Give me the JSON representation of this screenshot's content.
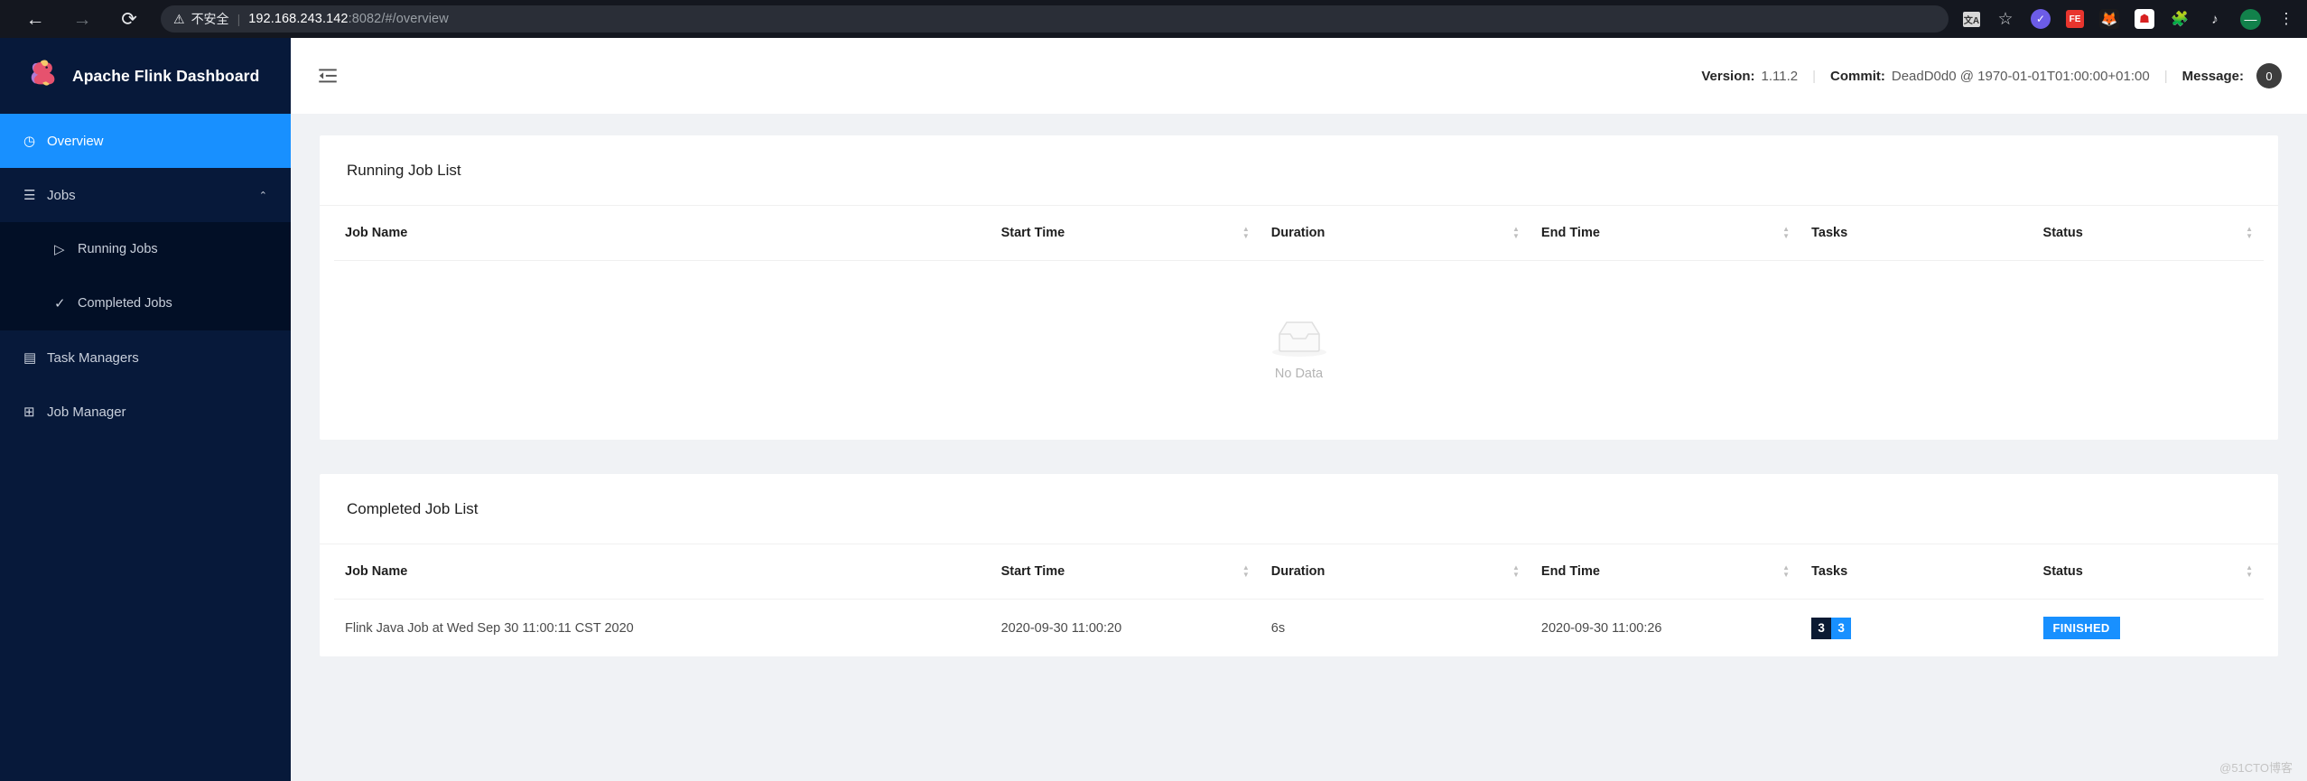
{
  "browser": {
    "nav": {
      "back_icon": "arrow-left-icon",
      "forward_icon": "arrow-right-icon",
      "reload_icon": "reload-icon",
      "back_glyph": "←",
      "forward_glyph": "→",
      "reload_glyph": "⟳"
    },
    "omnibox": {
      "warning_glyph": "⚠",
      "security_text": "不安全",
      "separator": "|",
      "url_host": "192.168.243.142",
      "url_rest": ":8082/#/overview"
    },
    "toolbar_icons": [
      {
        "name": "translate-icon",
        "glyph": "文A"
      },
      {
        "name": "bookmark-star-icon",
        "glyph": "☆"
      },
      {
        "name": "extension-check-icon",
        "glyph": "✓"
      },
      {
        "name": "extension-fe-icon",
        "glyph": "FE"
      },
      {
        "name": "extension-fox-icon",
        "glyph": "🦊"
      },
      {
        "name": "extension-network-icon",
        "glyph": "☗"
      },
      {
        "name": "extensions-puzzle-icon",
        "glyph": "🧩"
      },
      {
        "name": "reading-list-icon",
        "glyph": "♪"
      },
      {
        "name": "profile-avatar-icon",
        "glyph": "—"
      },
      {
        "name": "chrome-menu-icon",
        "glyph": "⋮"
      }
    ]
  },
  "sidebar": {
    "brand_title": "Apache Flink Dashboard",
    "brand_logo_name": "flink-squirrel-logo",
    "items": [
      {
        "label": "Overview",
        "icon": "dashboard-icon",
        "icon_glyph": "◷",
        "active": true,
        "level": 0,
        "chevron": ""
      },
      {
        "label": "Jobs",
        "icon": "list-icon",
        "icon_glyph": "☰",
        "active": false,
        "level": 0,
        "chevron": "⌃"
      },
      {
        "label": "Running Jobs",
        "icon": "play-circle-icon",
        "icon_glyph": "▷",
        "active": false,
        "level": 1,
        "chevron": ""
      },
      {
        "label": "Completed Jobs",
        "icon": "check-circle-icon",
        "icon_glyph": "✓",
        "active": false,
        "level": 1,
        "chevron": ""
      },
      {
        "label": "Task Managers",
        "icon": "task-manager-icon",
        "icon_glyph": "▤",
        "active": false,
        "level": 0,
        "chevron": ""
      },
      {
        "label": "Job Manager",
        "icon": "job-manager-icon",
        "icon_glyph": "⊞",
        "active": false,
        "level": 0,
        "chevron": ""
      }
    ]
  },
  "topbar": {
    "fold_icon": "menu-fold-icon",
    "version_label": "Version:",
    "version_value": "1.11.2",
    "commit_label": "Commit:",
    "commit_value": "DeadD0d0 @ 1970-01-01T01:00:00+01:00",
    "message_label": "Message:",
    "message_count": "0",
    "separator": "|"
  },
  "running_jobs": {
    "title": "Running Job List",
    "columns": [
      "Job Name",
      "Start Time",
      "Duration",
      "End Time",
      "Tasks",
      "Status"
    ],
    "rows": [],
    "empty_text": "No Data",
    "empty_icon": "inbox-icon"
  },
  "completed_jobs": {
    "title": "Completed Job List",
    "columns": [
      "Job Name",
      "Start Time",
      "Duration",
      "End Time",
      "Tasks",
      "Status"
    ],
    "rows": [
      {
        "job_name": "Flink Java Job at Wed Sep 30 11:00:11 CST 2020",
        "start_time": "2020-09-30 11:00:20",
        "duration": "6s",
        "end_time": "2020-09-30 11:00:26",
        "tasks_total": "3",
        "tasks_finished": "3",
        "status": "FINISHED"
      }
    ]
  },
  "watermark": "@51CTO博客",
  "colors": {
    "accent_blue": "#1890ff",
    "sidebar_bg": "#07193a",
    "subnav_bg": "#020f26",
    "page_bg": "#f0f2f5",
    "chip_dark": "#0b1a33"
  }
}
